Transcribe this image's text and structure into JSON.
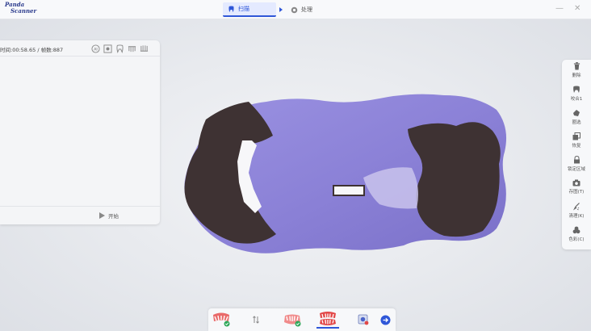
{
  "app": {
    "logo_line1": "Panda",
    "logo_line2": "Scanner"
  },
  "stepper": {
    "scan_label": "扫描",
    "process_label": "处理"
  },
  "window": {
    "minimize_icon": "minimize-icon",
    "close_icon": "close-icon"
  },
  "scan_panel": {
    "info_text": "时间:00:58.65 / 帧数:887",
    "icons": [
      "ai-icon",
      "focus-icon",
      "tooth-icon",
      "upper-jaw-icon",
      "lower-jaw-icon"
    ],
    "start_label": "开始"
  },
  "toolbar": {
    "items": [
      {
        "label": "删除",
        "icon": "trash-icon"
      },
      {
        "label": "咬合1",
        "icon": "bite-icon"
      },
      {
        "label": "圈选",
        "icon": "lasso-icon"
      },
      {
        "label": "恢复",
        "icon": "restore-icon"
      },
      {
        "label": "锁定区域",
        "icon": "lock-icon"
      },
      {
        "label": "存图(T)",
        "icon": "camera-icon"
      },
      {
        "label": "清理(K)",
        "icon": "clean-icon"
      },
      {
        "label": "色彩(C)",
        "icon": "color-icon"
      }
    ]
  },
  "bottom_bar": {
    "items": [
      "upper-jaw-icon",
      "swap-icon",
      "lower-jaw-icon",
      "bite-jaw-icon",
      "preview-icon",
      "next-icon"
    ]
  },
  "colors": {
    "accent": "#2f57d8",
    "model_purple": "#8f86d9",
    "model_dark": "#3e3233"
  }
}
